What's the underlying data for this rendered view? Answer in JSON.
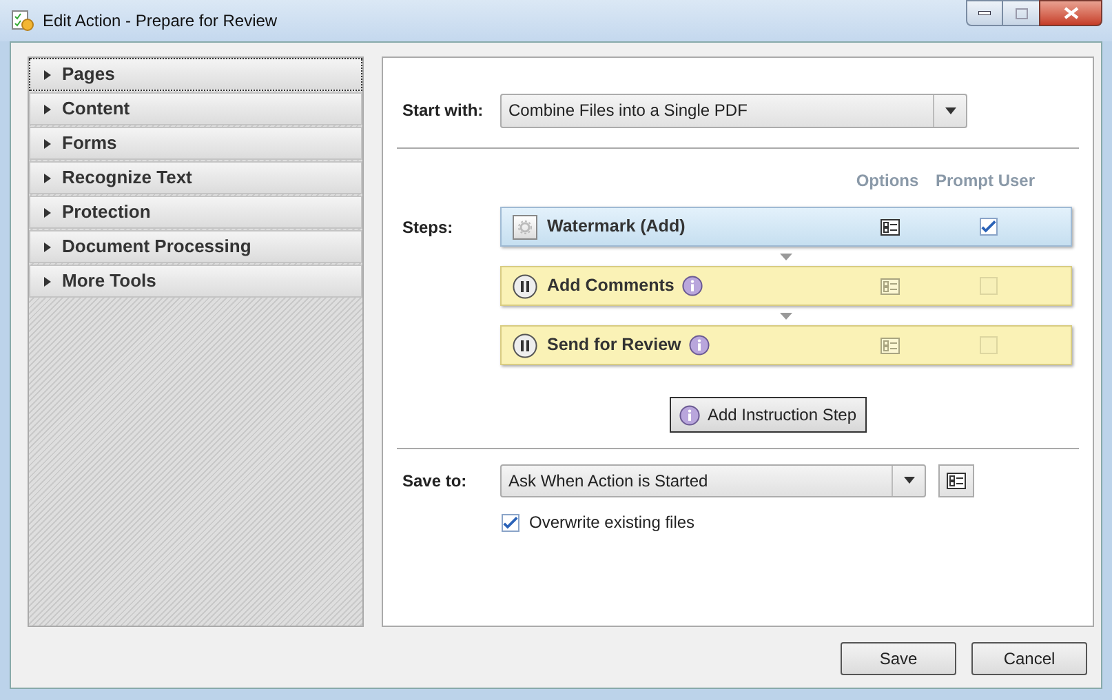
{
  "window": {
    "title": "Edit Action - Prepare for Review"
  },
  "sidebar": {
    "items": [
      {
        "label": "Pages",
        "focused": true
      },
      {
        "label": "Content",
        "focused": false
      },
      {
        "label": "Forms",
        "focused": false
      },
      {
        "label": "Recognize Text",
        "focused": false
      },
      {
        "label": "Protection",
        "focused": false
      },
      {
        "label": "Document Processing",
        "focused": false
      },
      {
        "label": "More Tools",
        "focused": false
      }
    ]
  },
  "start_with": {
    "label": "Start with:",
    "value": "Combine Files into a Single PDF"
  },
  "steps": {
    "label": "Steps:",
    "columns": [
      "Options",
      "Prompt User"
    ],
    "items": [
      {
        "kind": "action",
        "name": "Watermark (Add)",
        "prompt_user": true
      },
      {
        "kind": "instruction",
        "name": "Add Comments",
        "prompt_user": false
      },
      {
        "kind": "instruction",
        "name": "Send for Review",
        "prompt_user": false
      }
    ]
  },
  "add_instruction_button": "Add Instruction Step",
  "save_to": {
    "label": "Save to:",
    "value": "Ask When Action is Started"
  },
  "overwrite": {
    "label": "Overwrite existing files",
    "checked": true
  },
  "buttons": [
    "Save",
    "Cancel"
  ]
}
